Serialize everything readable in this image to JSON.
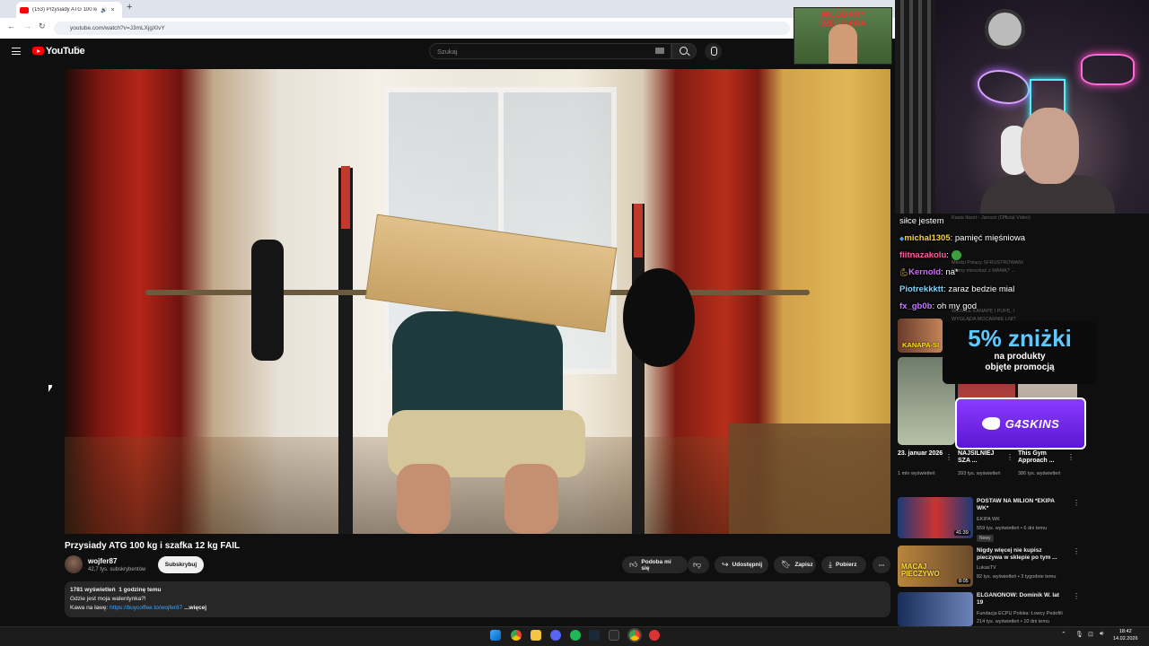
{
  "browser": {
    "tab_title": "(153) Przysiady ATG 100 kg",
    "tab_close": "×",
    "new_tab": "+",
    "url": "youtube.com/watch?v=J3mLXjgXIvY",
    "nav_back": "←",
    "nav_forward": "→",
    "nav_reload": "↻"
  },
  "youtube": {
    "logo_text": "YouTube",
    "region": "PL",
    "search_placeholder": "Szukaj"
  },
  "video": {
    "title": "Przysiady ATG 100 kg i szafka 12 kg FAIL",
    "channel_name": "wojfer87",
    "subscribers": "42,7 tys. subskrybentów",
    "subscribe_label": "Subskrybuj",
    "like_label": "Podoba mi się",
    "share_label": "Udostępnij",
    "save_label": "Zapisz",
    "download_label": "Pobierz",
    "more_actions": "⋯",
    "description": {
      "views": "1781 wyświetleń",
      "age": "1 godzinę temu",
      "line2": "Gdzie jest moja walentynka?!",
      "line3_prefix": "Kawa na ławę:",
      "link": "https://buycoffee.to/wojfer87",
      "more": "...więcej"
    }
  },
  "overlay": {
    "poster_text": "WŁODARY WEDGARA",
    "chat": [
      {
        "user": "",
        "message": "siłce jestem",
        "color": "#ffffff"
      },
      {
        "user": "michal1305",
        "message": ": pamięć mięśniowa",
        "color": "#f5d442"
      },
      {
        "user": "fiitnazakolu",
        "message": ":",
        "color": "#ff5fa2"
      },
      {
        "user": "Kernold",
        "message": ": na*",
        "color": "#d36bff"
      },
      {
        "user": "Piotrekkktt",
        "message": ": zaraz bedzie mial",
        "color": "#7ad4ff"
      },
      {
        "user": "fx_gb0b",
        "message": ": oh my god",
        "color": "#c279ff"
      }
    ],
    "ghost_lines": [
      "Kasia Ilaszt - Jaruzzi (Official Video)",
      "Młodzi Polacy SFRUSTROWANI",
      "Mamy mieszkać z MAMĄ? ...",
      "WSTAŁE KANAPĘ I PUFĘ, I",
      "WYGLĄDA MOCARNIE LNI?"
    ],
    "promo_big": "5% zniżki",
    "promo_line1": "na produkty",
    "promo_line2": "objęte promocją",
    "sponsor": "G4SKINS",
    "kanapa_label": "KANAPA-SI"
  },
  "shorts": [
    {
      "title": "23. januar 2026",
      "meta": "1 mln wyświetleń"
    },
    {
      "title": "NAJSILNIEJ SZA ...",
      "meta": "393 tys. wyświetleń"
    },
    {
      "title": "This Gym Approach ...",
      "meta": "386 tys. wyświetleń"
    }
  ],
  "recommendations": [
    {
      "title": "POSTAW NA MILION *EKIPA WK*",
      "channel": "EKIPA WK",
      "meta": "559 tys. wyświetleń • 6 dni temu",
      "duration": "41:39",
      "badge": "Nowy"
    },
    {
      "title": "Nigdy więcej nie kupisz pieczywa w sklepie po tym ...",
      "channel": "LukasTV",
      "meta": "82 tys. wyświetleń • 3 tygodnie temu",
      "duration": "8:05"
    },
    {
      "title": "ELGANONOW: Dominik W. lat 19",
      "channel": "Fundacja ECPU Polska: Łowcy Pedofili",
      "meta": "214 tys. wyświetleń • 10 dni temu",
      "duration": ""
    }
  ],
  "thumb_label_2": "MACAJ PIECZYWO",
  "taskbar": {
    "time": "18:42",
    "date": "14.02.2026"
  }
}
